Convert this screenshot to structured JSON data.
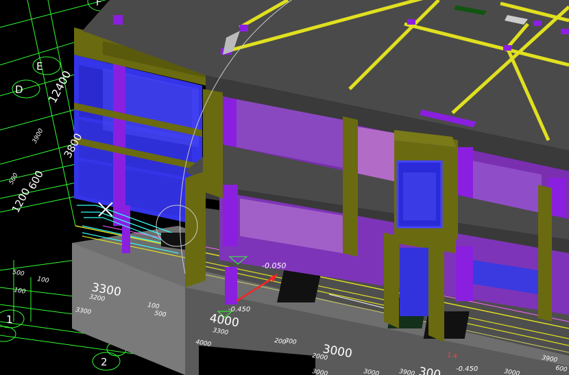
{
  "viewport": {
    "background": "#000000",
    "grid_bubbles": [
      "E",
      "D",
      "1",
      "2",
      "F"
    ],
    "dimensions_white": [
      "3300",
      "4000",
      "3000",
      "300",
      "12400",
      "3800",
      "1200",
      "600"
    ],
    "dimensions_small": [
      "3200",
      "3300",
      "500",
      "100",
      "100",
      "500",
      "100",
      "3300",
      "4000",
      "200",
      "300",
      "2000",
      "3900",
      "3000",
      "3900",
      "3000",
      "500",
      "3900",
      "600",
      "3000"
    ],
    "elevation_labels": [
      "-0.050",
      "-0.450",
      "-0.450"
    ],
    "red_labels": [
      "1.4"
    ],
    "colors": {
      "slab": "#4a4a4a",
      "column": "#6a6a10",
      "glass_blue": "#3a3af0",
      "wall_purple": "#8a2be2",
      "beam_yellow": "#e0e020",
      "axis_green": "#33ff33",
      "axis_cyan": "#33ffff"
    }
  }
}
